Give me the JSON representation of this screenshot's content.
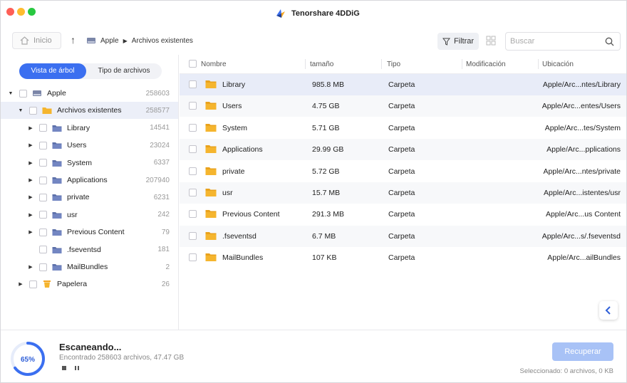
{
  "app": {
    "title": "Tenorshare 4DDiG"
  },
  "toolbar": {
    "home_label": "Inicio",
    "breadcrumb": [
      "Apple",
      "Archivos existentes"
    ],
    "filter_label": "Filtrar",
    "search_placeholder": "Buscar"
  },
  "sidebar": {
    "tabs": [
      "Vista de árbol",
      "Tipo de archivos"
    ],
    "active_tab": "Vista de árbol",
    "tree": [
      {
        "label": "Apple",
        "count": "258603",
        "depth": 0,
        "expanded": true,
        "icon": "hdd-icon"
      },
      {
        "label": "Archivos existentes",
        "count": "258577",
        "depth": 1,
        "expanded": true,
        "icon": "folder-yellow-icon",
        "selected": true
      },
      {
        "label": "Library",
        "count": "14541",
        "depth": 2,
        "expanded": false,
        "icon": "folder-blue-icon"
      },
      {
        "label": "Users",
        "count": "23024",
        "depth": 2,
        "expanded": false,
        "icon": "folder-blue-icon"
      },
      {
        "label": "System",
        "count": "6337",
        "depth": 2,
        "expanded": false,
        "icon": "folder-blue-icon"
      },
      {
        "label": "Applications",
        "count": "207940",
        "depth": 2,
        "expanded": false,
        "icon": "folder-blue-icon"
      },
      {
        "label": "private",
        "count": "6231",
        "depth": 2,
        "expanded": false,
        "icon": "folder-blue-icon"
      },
      {
        "label": "usr",
        "count": "242",
        "depth": 2,
        "expanded": false,
        "icon": "folder-blue-icon"
      },
      {
        "label": "Previous Content",
        "count": "79",
        "depth": 2,
        "expanded": false,
        "icon": "folder-blue-icon"
      },
      {
        "label": ".fseventsd",
        "count": "181",
        "depth": 2,
        "expanded": null,
        "icon": "folder-blue-icon"
      },
      {
        "label": "MailBundles",
        "count": "2",
        "depth": 2,
        "expanded": false,
        "icon": "folder-blue-icon"
      },
      {
        "label": "Papelera",
        "count": "26",
        "depth": 1,
        "expanded": false,
        "icon": "trash-icon"
      }
    ]
  },
  "table": {
    "columns": [
      "Nombre",
      "tamaño",
      "Tipo",
      "Modificación",
      "Ubicación"
    ],
    "rows": [
      {
        "name": "Library",
        "size": "985.8 MB",
        "type": "Carpeta",
        "modified": "",
        "location": "Apple/Arc...ntes/Library"
      },
      {
        "name": "Users",
        "size": "4.75 GB",
        "type": "Carpeta",
        "modified": "",
        "location": "Apple/Arc...entes/Users"
      },
      {
        "name": "System",
        "size": "5.71 GB",
        "type": "Carpeta",
        "modified": "",
        "location": "Apple/Arc...tes/System"
      },
      {
        "name": "Applications",
        "size": "29.99 GB",
        "type": "Carpeta",
        "modified": "",
        "location": "Apple/Arc...pplications"
      },
      {
        "name": "private",
        "size": "5.72 GB",
        "type": "Carpeta",
        "modified": "",
        "location": "Apple/Arc...ntes/private"
      },
      {
        "name": "usr",
        "size": "15.7 MB",
        "type": "Carpeta",
        "modified": "",
        "location": "Apple/Arc...istentes/usr"
      },
      {
        "name": "Previous Content",
        "size": "291.3 MB",
        "type": "Carpeta",
        "modified": "",
        "location": "Apple/Arc...us Content"
      },
      {
        "name": ".fseventsd",
        "size": "6.7 MB",
        "type": "Carpeta",
        "modified": "",
        "location": "Apple/Arc...s/.fseventsd"
      },
      {
        "name": "MailBundles",
        "size": "107 KB",
        "type": "Carpeta",
        "modified": "",
        "location": "Apple/Arc...ailBundles"
      }
    ]
  },
  "status": {
    "progress_percent": 65,
    "progress_label": "65%",
    "title": "Escaneando...",
    "subtitle": "Encontrado 258603 archivos, 47.47 GB",
    "recover_label": "Recuperar",
    "selection_info": "Seleccionado: 0 archivos, 0 KB"
  },
  "colors": {
    "accent": "#3b6ff0",
    "folder_yellow": "#f5b52e",
    "folder_blue": "#5b6fa8",
    "recover_disabled": "#a8c2f6"
  }
}
